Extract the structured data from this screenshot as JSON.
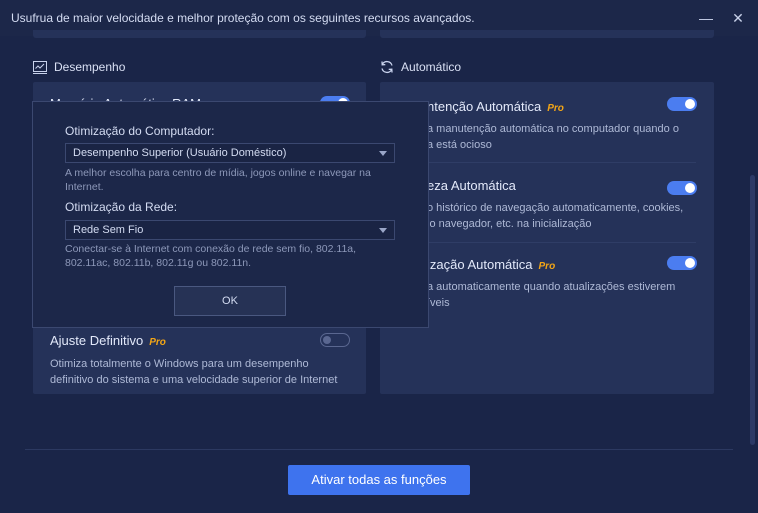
{
  "window": {
    "title": "Usufrua de maior velocidade e melhor proteção com os seguintes recursos avançados.",
    "minimize_glyph": "—",
    "close_glyph": "✕"
  },
  "sections": {
    "left_title": "Desempenho",
    "right_title": "Automático"
  },
  "left_panel": {
    "hidden_item_title": "Memória Automática RAM",
    "items": [
      {
        "title": "Ajuste Definitivo",
        "pro": "Pro",
        "desc": "Otimiza totalmente o Windows para um desempenho definitivo do sistema e uma velocidade superior de Internet",
        "toggle": "off"
      }
    ]
  },
  "right_panel": {
    "items": [
      {
        "title": "ntenção Automática",
        "pro": "Pro",
        "desc": "a manutenção automática no computador quando o\na está ocioso",
        "toggle": "on"
      },
      {
        "title": "eza Automática",
        "pro": "",
        "desc": "o histórico de navegação automaticamente, cookies,\nlo navegador, etc. na inicialização",
        "toggle": "on"
      },
      {
        "title": "ização Automática",
        "pro": "Pro",
        "desc": "a automaticamente quando atualizações estiverem\níveis",
        "toggle": "on"
      }
    ]
  },
  "footer": {
    "activate_all_label": "Ativar todas as funções"
  },
  "dialog": {
    "computer_label": "Otimização do Computador:",
    "computer_value": "Desempenho Superior (Usuário Doméstico)",
    "computer_desc": "A melhor escolha para centro de mídia, jogos online e navegar na Internet.",
    "network_label": "Otimização da Rede:",
    "network_value": "Rede Sem Fio",
    "network_desc": "Conectar-se à Internet com conexão de rede sem fio, 802.11a, 802.11ac, 802.11b, 802.11g ou 802.11n.",
    "ok_label": "OK"
  },
  "colors": {
    "background": "#1a2548",
    "panel": "#253259",
    "accent": "#3e73ee",
    "pro": "#f2a516"
  }
}
